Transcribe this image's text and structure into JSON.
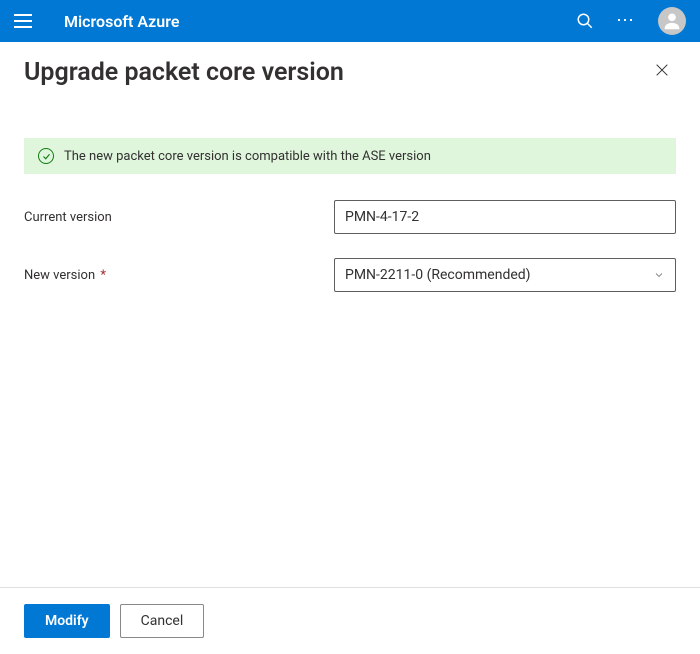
{
  "header": {
    "brand": "Microsoft Azure"
  },
  "panel": {
    "title": "Upgrade packet core version"
  },
  "notice": {
    "message": "The new packet core version is compatible with the ASE version",
    "status_color": "#107c10",
    "bg_color": "#dff6dd"
  },
  "form": {
    "current_version": {
      "label": "Current version",
      "value": "PMN-4-17-2"
    },
    "new_version": {
      "label": "New version",
      "required_marker": "*",
      "value": "PMN-2211-0 (Recommended)"
    }
  },
  "footer": {
    "primary": "Modify",
    "secondary": "Cancel"
  },
  "colors": {
    "primary": "#0078d4"
  }
}
